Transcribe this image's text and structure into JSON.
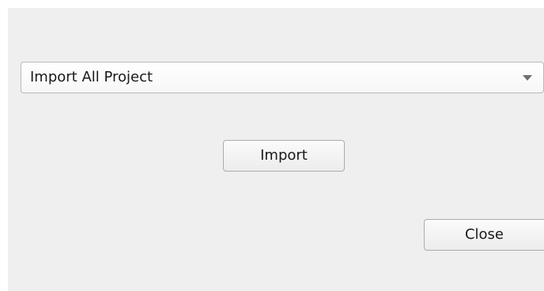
{
  "import_mode": {
    "selected": "Import All Project",
    "icon": "chevron-down-icon"
  },
  "buttons": {
    "import_label": "Import",
    "close_label": "Close"
  }
}
